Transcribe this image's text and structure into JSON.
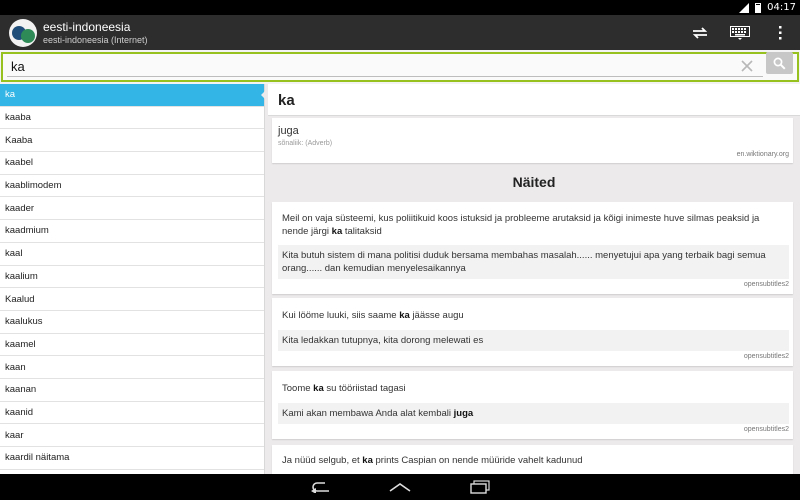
{
  "status": {
    "time": "04:17"
  },
  "app": {
    "title": "eesti-indoneesia",
    "subtitle": "eesti-indoneesia (Internet)"
  },
  "search": {
    "value": "ka"
  },
  "word_list": [
    "ka",
    "kaaba",
    "Kaaba",
    "kaabel",
    "kaablimodem",
    "kaader",
    "kaadmium",
    "kaal",
    "kaalium",
    "Kaalud",
    "kaalukus",
    "kaamel",
    "kaan",
    "kaanan",
    "kaanid",
    "kaar",
    "kaardil näitama",
    "kaardiväli"
  ],
  "selected_index": 0,
  "entry": {
    "headword": "ka",
    "translation": "juga",
    "part_of_speech": "sõnaliik: (Adverb)",
    "source": "en.wiktionary.org"
  },
  "examples_title": "Näited",
  "examples": [
    {
      "source_html": "Meil on vaja süsteemi, kus poliitikuid koos istuksid ja probleeme arutaksid ja kõigi inimeste huve silmas peaksid ja nende järgi <b>ka</b> talitaksid",
      "translation_html": "Kita butuh sistem di mana politisi duduk bersama membahas masalah...... menyetujui apa yang terbaik bagi semua orang...... dan kemudian menyelesaikannya",
      "origin": "opensubtitles2"
    },
    {
      "source_html": "Kui lööme luuki, siis saame <b>ka</b> jäässe augu",
      "translation_html": "Kita ledakkan tutupnya, kita dorong melewati es",
      "origin": "opensubtitles2"
    },
    {
      "source_html": "Toome <b>ka</b> su tööriistad tagasi",
      "translation_html": "Kami akan membawa Anda alat kembali <b>juga</b>",
      "origin": "opensubtitles2"
    },
    {
      "source_html": "Ja nüüd selgub, et <b>ka</b> prints Caspian on nende müüride vahelt kadunud",
      "translation_html": "",
      "origin": ""
    }
  ],
  "colors": {
    "accent_blue": "#33b5e5",
    "search_border": "#96c11f",
    "action_bar": "#2d2d2d"
  },
  "icons": {
    "sync": "sync-icon",
    "keyboard": "keyboard-icon",
    "overflow": "overflow-menu-icon",
    "clear": "clear-icon",
    "search": "search-icon",
    "back": "back-icon",
    "home": "home-icon",
    "recents": "recents-icon"
  }
}
